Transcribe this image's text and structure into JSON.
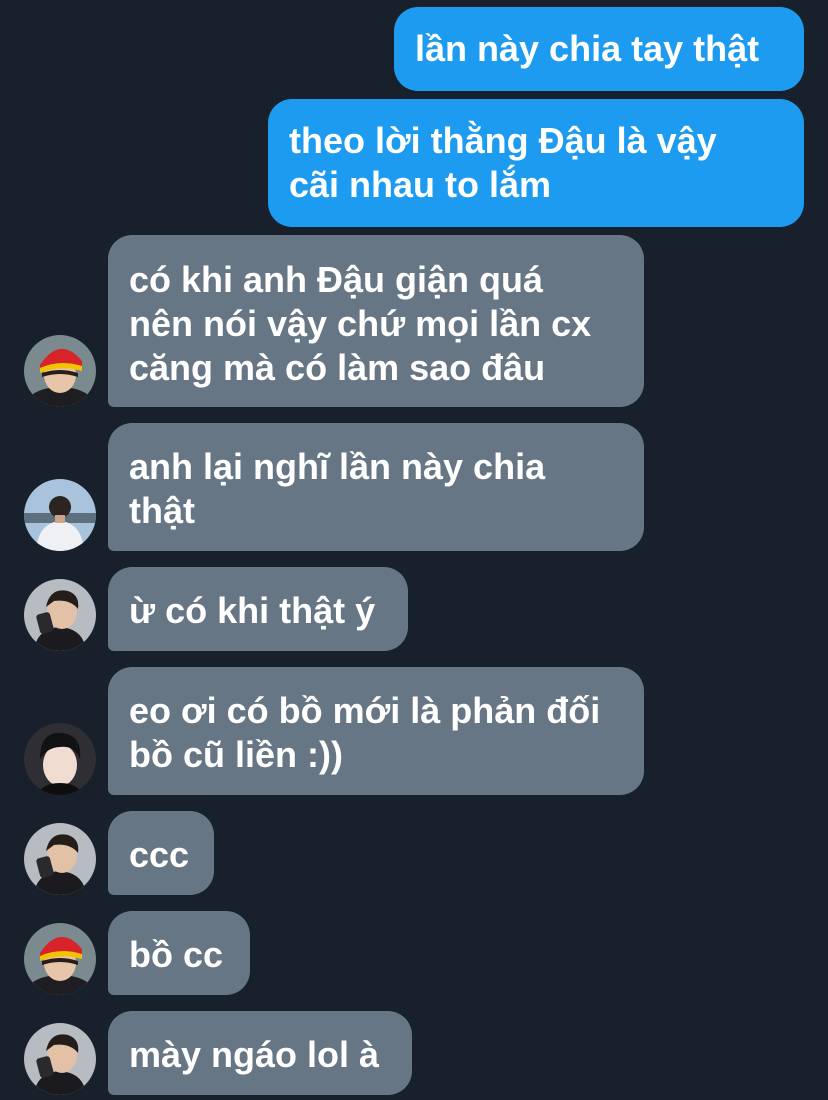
{
  "colors": {
    "background": "#17202b",
    "outgoing_bubble": "#1d9bf0",
    "incoming_bubble": "#677684",
    "text": "#ffffff"
  },
  "messages": [
    {
      "direction": "outgoing",
      "text": "lần này chia tay thật"
    },
    {
      "direction": "outgoing",
      "text": "theo lời thằng Đậu là vậy\ncãi nhau to lắm"
    },
    {
      "direction": "incoming",
      "avatar": "avatar-red-hat",
      "text": "có khi anh Đậu giận quá\nnên nói vậy chứ mọi lần cx\ncăng mà có làm sao đâu"
    },
    {
      "direction": "incoming",
      "avatar": "avatar-white-shirt",
      "text": "anh lại nghĩ lần này chia\nthật"
    },
    {
      "direction": "incoming",
      "avatar": "avatar-phone",
      "text": "ừ có khi thật ý"
    },
    {
      "direction": "incoming",
      "avatar": "avatar-dark-portrait",
      "text": "eo ơi có bồ mới là phản đối\nbồ cũ liền :))"
    },
    {
      "direction": "incoming",
      "avatar": "avatar-phone",
      "text": "ccc"
    },
    {
      "direction": "incoming",
      "avatar": "avatar-red-hat",
      "text": "bồ cc"
    },
    {
      "direction": "incoming",
      "avatar": "avatar-phone",
      "text": "mày ngáo lol à"
    }
  ]
}
